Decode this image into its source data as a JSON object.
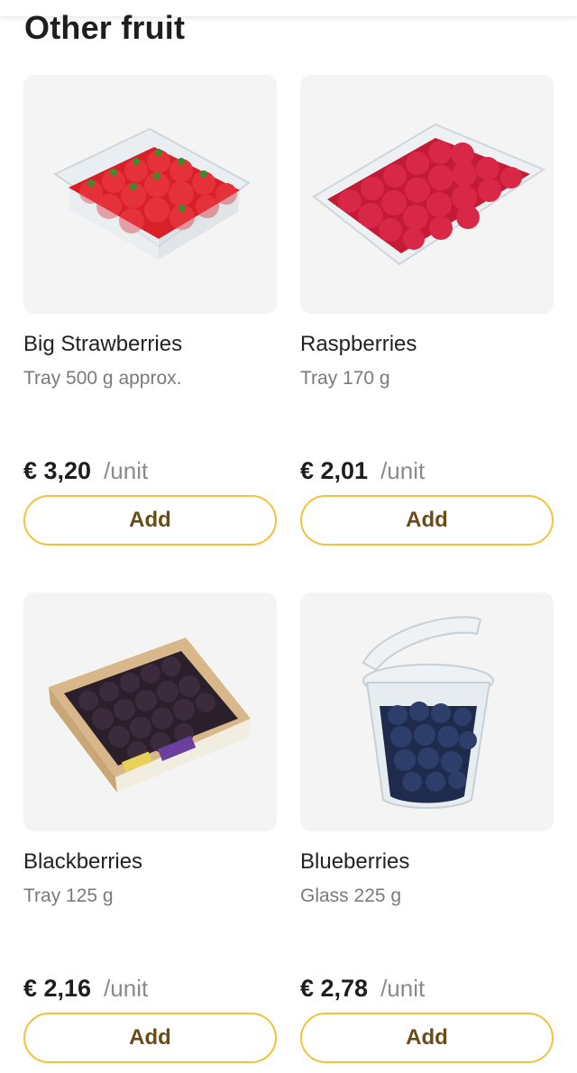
{
  "section_title": "Other fruit",
  "colors": {
    "accent": "#f2c23a",
    "button_text": "#6b4b16",
    "card_bg": "#f4f4f4"
  },
  "products": [
    {
      "name": "Big Strawberries",
      "unit": "Tray 500 g approx.",
      "price": "€ 3,20",
      "per_unit": "/unit",
      "button": "Add",
      "image": "strawberries-tray-image"
    },
    {
      "name": "Raspberries",
      "unit": "Tray 170 g",
      "price": "€ 2,01",
      "per_unit": "/unit",
      "button": "Add",
      "image": "raspberries-tray-image"
    },
    {
      "name": "Blackberries",
      "unit": "Tray 125 g",
      "price": "€ 2,16",
      "per_unit": "/unit",
      "button": "Add",
      "image": "blackberries-tray-image"
    },
    {
      "name": "Blueberries",
      "unit": "Glass 225 g",
      "price": "€ 2,78",
      "per_unit": "/unit",
      "button": "Add",
      "image": "blueberries-cup-image"
    }
  ]
}
